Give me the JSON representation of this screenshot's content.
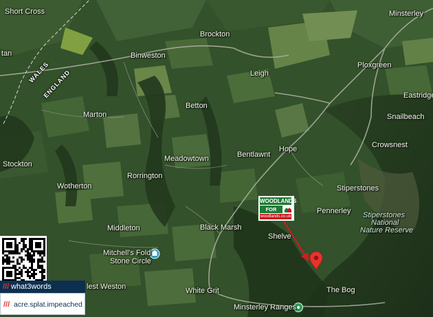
{
  "places": {
    "short_cross": "Short Cross",
    "brockton": "Brockton",
    "minsterley": "Minsterley",
    "tan": "tan",
    "binweston": "Binweston",
    "leigh": "Leigh",
    "ploxgreen": "Ploxgreen",
    "eastridge": "Eastridge",
    "betton": "Betton",
    "marton": "Marton",
    "snailbeach": "Snailbeach",
    "crowsnest": "Crowsnest",
    "hope": "Hope",
    "bentlawnt": "Bentlawnt",
    "meadowtown": "Meadowtown",
    "stockton": "Stockton",
    "rorrington": "Rorrington",
    "wotherton": "Wotherton",
    "stiperstones": "Stiperstones",
    "pennerley": "Pennerley",
    "middleton": "Middleton",
    "black_marsh": "Black Marsh",
    "shelve": "Shelve",
    "mitchells_fold_1": "Mitchell's Fold",
    "mitchells_fold_2": "Stone Circle",
    "west_weston": "lest Weston",
    "white_grit": "White Grit",
    "the_bog": "The Bog",
    "minsterley_ranges": "Minsterley Ranges",
    "nature_reserve_1": "Stiperstones",
    "nature_reserve_2": "National",
    "nature_reserve_3": "Nature Reserve"
  },
  "borders": {
    "wales": "WALES",
    "england": "ENGLAND"
  },
  "sale_sign": {
    "line1": "WOODLANDS",
    "line2": "FOR SALE",
    "website": "woodlands.co.uk"
  },
  "what3words": {
    "brand": "what3words",
    "slashes": "///",
    "address": "acre.splat.impeached"
  },
  "colors": {
    "brand_green": "#1f7a34",
    "brand_red": "#c5151e",
    "pin_red": "#e8332b",
    "w3w_navy": "#0d2f4f",
    "w3w_red": "#e1332d"
  },
  "icons": {
    "pin": "map-pin-icon",
    "stone_circle": "landmark-icon",
    "ranges": "place-marker-icon",
    "arrow": "pointer-arrow"
  }
}
